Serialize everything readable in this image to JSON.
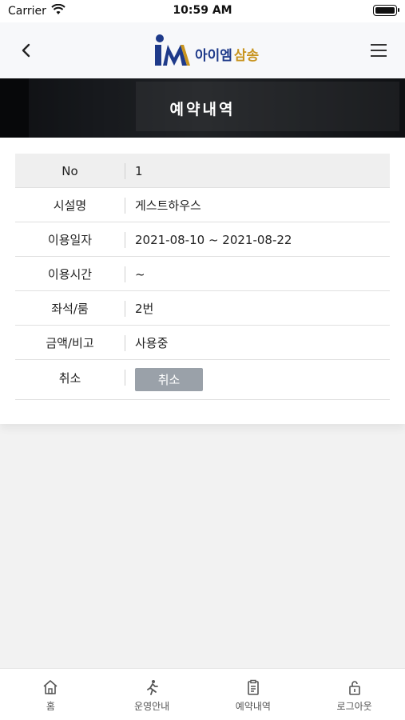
{
  "status_bar": {
    "carrier": "Carrier",
    "time": "10:59 AM"
  },
  "header": {
    "logo_text_main": "아이엠",
    "logo_text_sub": "삼송",
    "accent_color": "#1e3a8a",
    "brand_gold": "#c8941f"
  },
  "banner": {
    "title": "예약내역"
  },
  "reservation": {
    "rows": [
      {
        "label": "No",
        "value": "1"
      },
      {
        "label": "시설명",
        "value": "게스트하우스"
      },
      {
        "label": "이용일자",
        "value": "2021-08-10 ~ 2021-08-22"
      },
      {
        "label": "이용시간",
        "value": "~"
      },
      {
        "label": "좌석/룸",
        "value": "2번"
      },
      {
        "label": "금액/비고",
        "value": "사용중"
      }
    ],
    "cancel_label": "취소",
    "cancel_button_label": "취소"
  },
  "tabbar": {
    "items": [
      {
        "label": "홈",
        "icon": "home-icon"
      },
      {
        "label": "운영안내",
        "icon": "running-person-icon"
      },
      {
        "label": "예약내역",
        "icon": "clipboard-icon"
      },
      {
        "label": "로그아웃",
        "icon": "unlock-icon"
      }
    ]
  }
}
